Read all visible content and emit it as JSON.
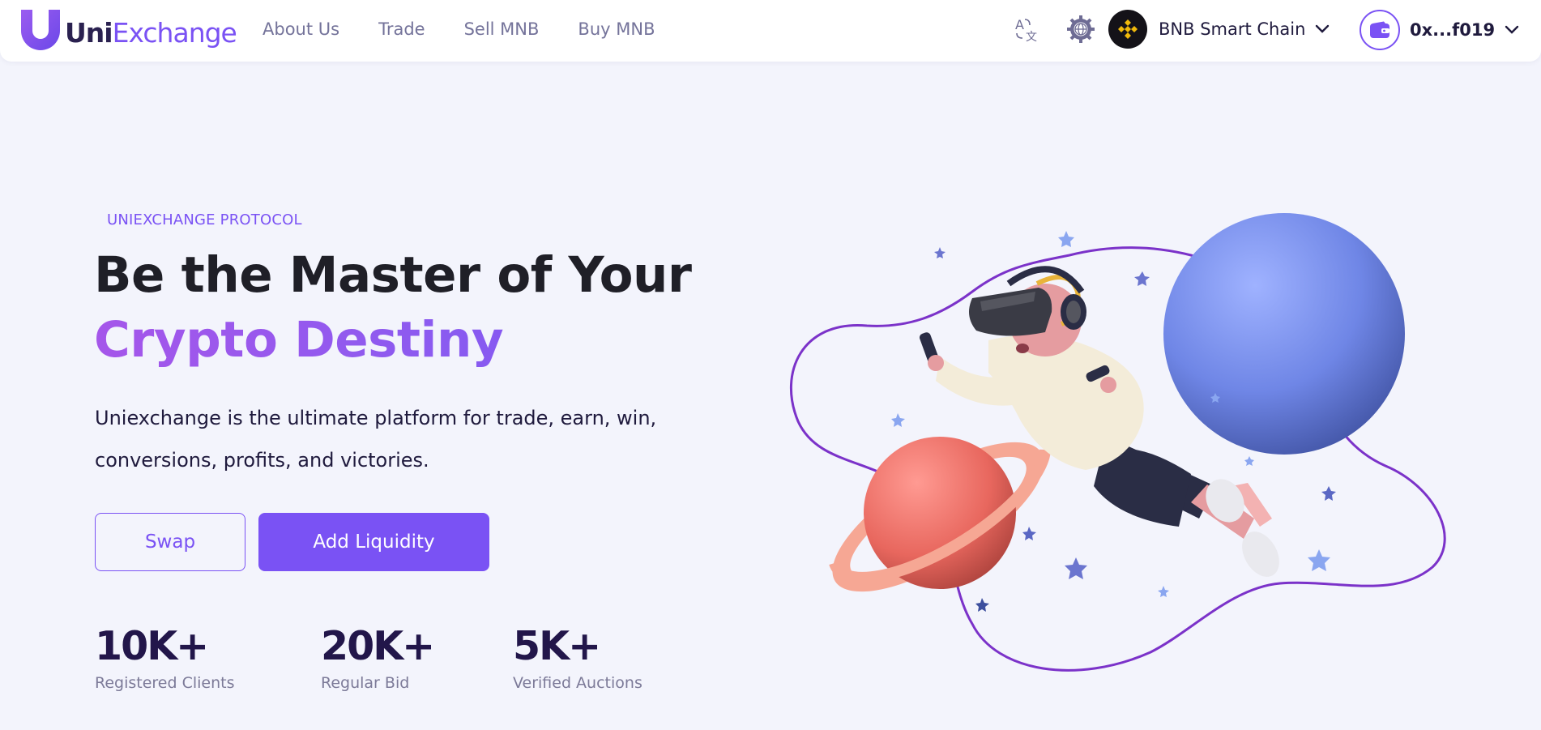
{
  "brand": {
    "name_part1": "Uni",
    "name_part2": "Exchange",
    "accent_color": "#7a52f4",
    "logo_icon": "shield-u-logo-icon"
  },
  "nav": {
    "links": [
      {
        "label": "About Us"
      },
      {
        "label": "Trade"
      },
      {
        "label": "Sell MNB"
      },
      {
        "label": "Buy MNB"
      }
    ],
    "language_icon": "translate-icon",
    "settings_icon": "globe-gear-icon",
    "chain": {
      "name": "BNB Smart Chain",
      "icon": "bnb-logo-icon"
    },
    "wallet": {
      "address": "0x...f019",
      "icon": "wallet-icon"
    }
  },
  "hero": {
    "kicker": "UNIEXCHANGE PROTOCOL",
    "title_line1": "Be the Master of Your",
    "title_line2": "Crypto Destiny",
    "description": "Uniexchange is the ultimate platform for trade, earn, win, conversions, profits, and victories.",
    "buttons": {
      "swap": "Swap",
      "add_liquidity": "Add Liquidity"
    }
  },
  "stats": [
    {
      "value": "10K+",
      "label": "Registered Clients"
    },
    {
      "value": "20K+",
      "label": "Regular Bid"
    },
    {
      "value": "5K+",
      "label": "Verified Auctions"
    }
  ],
  "illustration": {
    "icon": "vr-astronaut-planets-illustration"
  }
}
